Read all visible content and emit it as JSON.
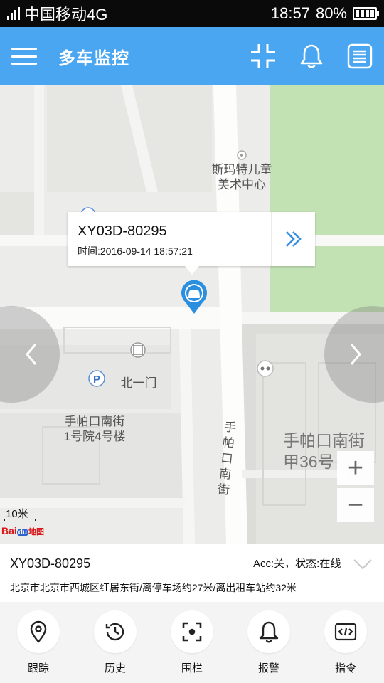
{
  "status_bar": {
    "carrier": "中国移动4G",
    "time": "18:57",
    "battery": "80%"
  },
  "header": {
    "title": "多车监控",
    "icons": [
      "menu-icon",
      "fullscreen-icon",
      "bell-icon",
      "list-icon"
    ]
  },
  "map": {
    "labels": {
      "poi_1": "斯玛特儿童",
      "poi_2": "美术中心",
      "gate": "北一门",
      "building_1": "手帕口南街",
      "building_2": "1号院4号楼",
      "road_chars": [
        "手",
        "帕",
        "口",
        "南",
        "街"
      ],
      "district_1": "手帕口南街",
      "district_2": "甲36号"
    },
    "scale": "10米",
    "logo": "Baidu地图",
    "popup": {
      "plate": "XY03D-80295",
      "time": "时间:2016-09-14 18:57:21"
    },
    "zoom_in": "+",
    "zoom_out": "−"
  },
  "info": {
    "plate": "XY03D-80295",
    "status": "Acc:关，状态:在线",
    "address": "北京市北京市西城区红居东街/离停车场约27米/离出租车站约32米"
  },
  "actions": [
    {
      "label": "跟踪",
      "icon": "location-pin-icon"
    },
    {
      "label": "历史",
      "icon": "history-icon"
    },
    {
      "label": "围栏",
      "icon": "fence-icon"
    },
    {
      "label": "报警",
      "icon": "alarm-bell-icon"
    },
    {
      "label": "指令",
      "icon": "command-icon"
    }
  ],
  "colors": {
    "header": "#4aa6f0",
    "map_bg": "#ececea",
    "park": "#c3e2b4",
    "marker": "#2b8fe0"
  }
}
